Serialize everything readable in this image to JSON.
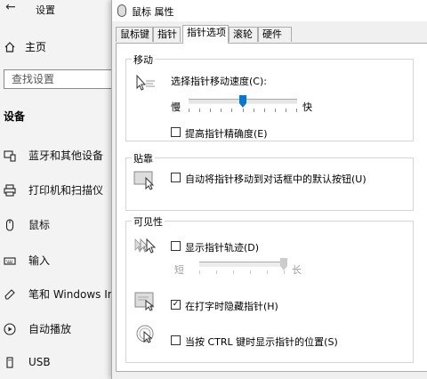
{
  "settings": {
    "title": "设置",
    "home_label": "主页",
    "search_placeholder": "查找设置",
    "section_label": "设备",
    "nav": [
      {
        "label": "蓝牙和其他设备",
        "icon": "bluetooth-devices-icon"
      },
      {
        "label": "打印机和扫描仪",
        "icon": "printer-icon"
      },
      {
        "label": "鼠标",
        "icon": "mouse-icon"
      },
      {
        "label": "输入",
        "icon": "keyboard-icon"
      },
      {
        "label": "笔和 Windows Ink",
        "icon": "pen-icon"
      },
      {
        "label": "自动播放",
        "icon": "autoplay-icon"
      },
      {
        "label": "USB",
        "icon": "usb-icon"
      }
    ]
  },
  "dialog": {
    "title": "鼠标 属性",
    "tabs": [
      "鼠标键",
      "指针",
      "指针选项",
      "滚轮",
      "硬件"
    ],
    "active_tab": "指针选项",
    "motion": {
      "group_label": "移动",
      "speed_label": "选择指针移动速度(C):",
      "slow": "慢",
      "fast": "快",
      "speed_value": 0.5,
      "precision_label": "提高指针精确度(E)",
      "precision_checked": false
    },
    "snap": {
      "group_label": "贴靠",
      "snap_label": "自动将指针移动到对话框中的默认按钮(U)",
      "snap_checked": false
    },
    "visibility": {
      "group_label": "可见性",
      "trails_label": "显示指针轨迹(D)",
      "trails_checked": false,
      "short": "短",
      "long": "长",
      "trail_value": 1.0,
      "hide_label": "在打字时隐藏指针(H)",
      "hide_checked": true,
      "ctrl_label": "当按 CTRL 键时显示指针的位置(S)",
      "ctrl_checked": false
    }
  }
}
